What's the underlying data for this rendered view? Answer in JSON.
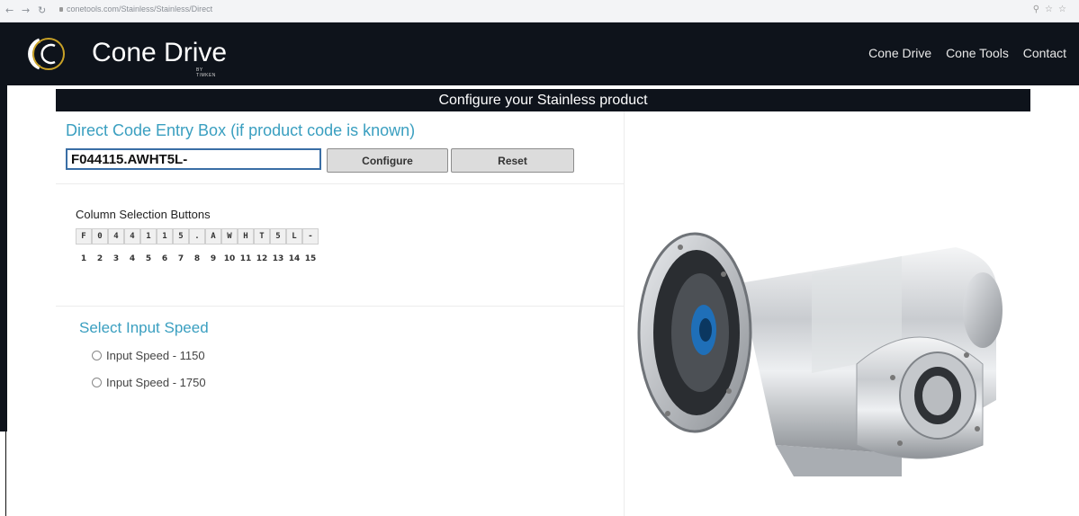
{
  "browser": {
    "address": "conetools.com/Stainless/Stainless/Direct"
  },
  "header": {
    "brand": "Cone Drive",
    "brand_sub": "BY TIMKEN",
    "nav": [
      "Cone Drive",
      "Cone Tools",
      "Contact"
    ]
  },
  "config": {
    "title": "Configure your Stainless product",
    "direct_title": "Direct Code Entry Box (if product code is known)",
    "code_value": "F044115.AWHT5L-",
    "configure_label": "Configure",
    "reset_label": "Reset",
    "columns_label": "Column Selection Buttons",
    "column_chars": [
      "F",
      "0",
      "4",
      "4",
      "1",
      "1",
      "5",
      ".",
      "A",
      "W",
      "H",
      "T",
      "5",
      "L",
      "-"
    ],
    "column_numbers": [
      "1",
      "2",
      "3",
      "4",
      "5",
      "6",
      "7",
      "8",
      "9",
      "10",
      "11",
      "12",
      "13",
      "14",
      "15"
    ],
    "speed_title": "Select Input Speed",
    "speed_options": [
      "Input Speed - 1150",
      "Input Speed - 1750"
    ]
  },
  "colors": {
    "header_bg": "#0e131b",
    "accent_blue": "#3a9fc0",
    "logo_gold": "#c9a227"
  },
  "icons": {
    "logo": "cone-drive-logo-icon",
    "product": "stainless-gear-reducer-image"
  }
}
